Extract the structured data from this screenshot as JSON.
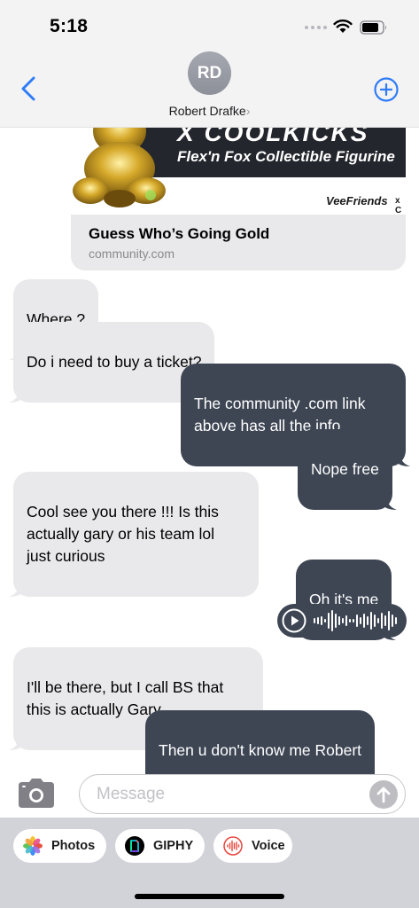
{
  "status": {
    "time": "5:18"
  },
  "header": {
    "avatar_initials": "RD",
    "contact_name": "Robert Drafke",
    "contact_chevron": "›"
  },
  "link_preview": {
    "banner_heading": "X COOLKICKS",
    "banner_subtitle": "Flex'n Fox Collectible Figurine",
    "brand": "VeeFriends",
    "brand_suffix": "x C",
    "title": "Guess Who’s Going Gold",
    "domain": "community.com"
  },
  "messages": [
    {
      "direction": "in",
      "text": "Where ?"
    },
    {
      "direction": "in",
      "text": "Do i need to buy a ticket?"
    },
    {
      "direction": "out",
      "text": "The community .com link\nabove has all the info"
    },
    {
      "direction": "out",
      "text": "Nope free"
    },
    {
      "direction": "in",
      "text": "Cool see you there !!! Is this\nactually gary or his team lol\njust curious"
    },
    {
      "direction": "out",
      "text": "Oh it's me"
    },
    {
      "direction": "out",
      "type": "audio"
    },
    {
      "direction": "in",
      "text": "I'll be there, but I call BS that\nthis is actually Gary"
    },
    {
      "direction": "out",
      "text": "Then u don't know me Robert"
    }
  ],
  "composer": {
    "placeholder": "Message"
  },
  "apps": [
    {
      "label": "Photos",
      "icon": "photos-icon"
    },
    {
      "label": "GIPHY",
      "icon": "giphy-icon"
    },
    {
      "label": "Voice",
      "icon": "voice-memo-icon"
    }
  ],
  "colors": {
    "outgoing_bubble": "#3e4654",
    "incoming_bubble": "#e9e9eb",
    "accent": "#2f7cf6"
  }
}
